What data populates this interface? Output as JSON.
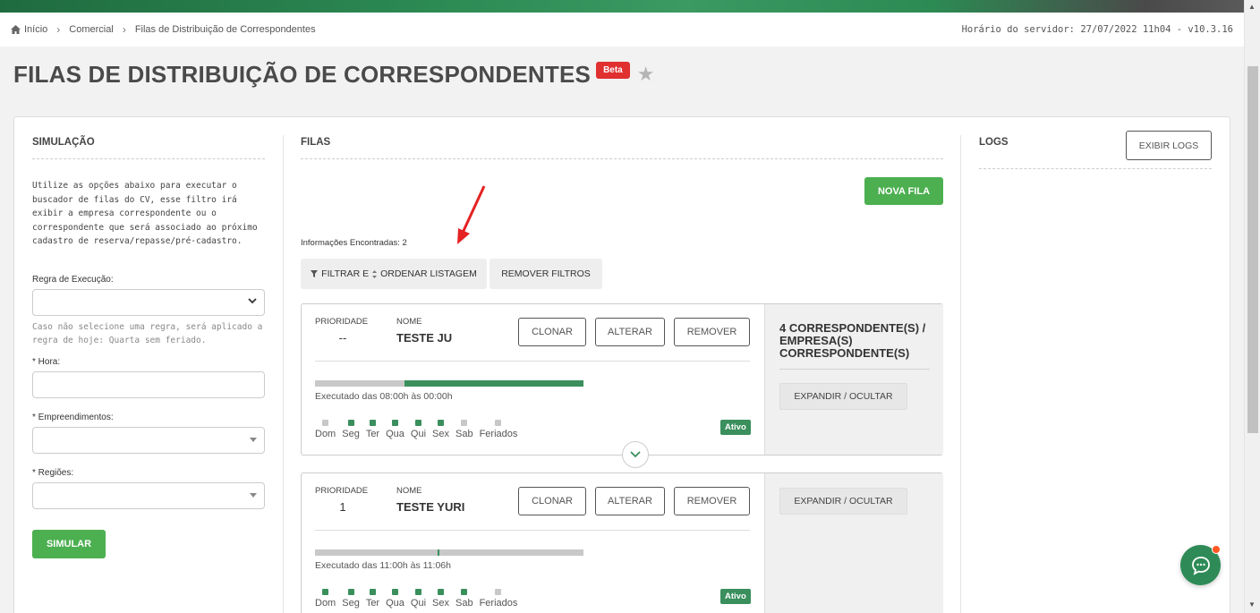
{
  "breadcrumb": {
    "items": [
      "Início",
      "Comercial",
      "Filas de Distribuição de Correspondentes"
    ],
    "server_time": "Horário do servidor: 27/07/2022 11h04 - v10.3.16"
  },
  "page": {
    "title": "FILAS DE DISTRIBUIÇÃO DE CORRESPONDENTES",
    "badge": "Beta"
  },
  "simulacao": {
    "heading": "SIMULAÇÃO",
    "description": "Utilize as opções abaixo para executar o buscador de filas do CV, esse filtro irá exibir a empresa correspondente ou o correspondente que será associado ao próximo cadastro de reserva/repasse/pré-cadastro.",
    "regra_label": "Regra de Execução:",
    "regra_value": "",
    "regra_hint": "Caso não selecione uma regra, será aplicado a regra de hoje: Quarta sem feriado.",
    "hora_label": "* Hora:",
    "hora_value": "",
    "empreendimentos_label": "* Empreendimentos:",
    "regioes_label": "* Regiões:",
    "simular_label": "SIMULAR"
  },
  "filas": {
    "heading": "FILAS",
    "nova_fila_label": "NOVA FILA",
    "info_found": "Informações Encontradas: 2",
    "filtrar_label": "FILTRAR E",
    "ordenar_label": "ORDENAR LISTAGEM",
    "remover_filtros_label": "REMOVER FILTROS",
    "priority_label": "PRIORIDADE",
    "name_label": "NOME",
    "clonar_label": "CLONAR",
    "alterar_label": "ALTERAR",
    "remover_label": "REMOVER",
    "expand_label": "EXPANDIR / OCULTAR",
    "status_label": "Ativo",
    "day_labels": [
      "Dom",
      "Seg",
      "Ter",
      "Qua",
      "Qui",
      "Sex",
      "Sab",
      "Feriados"
    ],
    "queues": [
      {
        "priority": "--",
        "name": "TESTE JU",
        "executed": "Executado das 08:00h às 00:00h",
        "days_active": [
          false,
          true,
          true,
          true,
          true,
          true,
          false,
          false
        ],
        "correspondents": "4 CORRESPONDENTE(S) / EMPRESA(S) CORRESPONDENTE(S)"
      },
      {
        "priority": "1",
        "name": "TESTE YURI",
        "executed": "Executado das 11:00h às 11:06h",
        "days_active": [
          true,
          true,
          true,
          true,
          true,
          true,
          true,
          false
        ],
        "correspondents": ""
      }
    ]
  },
  "logs": {
    "heading": "LOGS",
    "exibir_label": "EXIBIR LOGS"
  },
  "colors": {
    "brand_green": "#3a8f5d",
    "button_green": "#4caf50",
    "beta_red": "#e03030",
    "annotation_red": "#e52222"
  }
}
